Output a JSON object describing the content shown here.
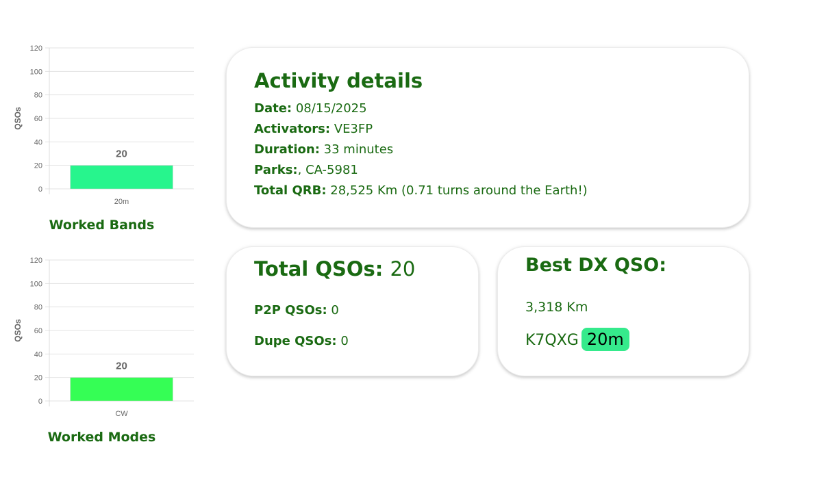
{
  "charts": [
    {
      "id": "bands",
      "caption": "Worked Bands",
      "ylabel": "QSOs",
      "bar_color": "#27f58d",
      "chart_data": {
        "type": "bar",
        "categories": [
          "20m"
        ],
        "values": [
          20
        ],
        "ylim": [
          0,
          120
        ],
        "yticks": [
          0,
          20,
          40,
          60,
          80,
          100,
          120
        ],
        "ylabel": "QSOs",
        "xlabel": "",
        "title": ""
      }
    },
    {
      "id": "modes",
      "caption": "Worked Modes",
      "ylabel": "QSOs",
      "bar_color": "#35fe55",
      "chart_data": {
        "type": "bar",
        "categories": [
          "CW"
        ],
        "values": [
          20
        ],
        "ylim": [
          0,
          120
        ],
        "yticks": [
          0,
          20,
          40,
          60,
          80,
          100,
          120
        ],
        "ylabel": "QSOs",
        "xlabel": "",
        "title": ""
      }
    }
  ],
  "activity": {
    "title": "Activity details",
    "date_label": "Date:",
    "date_value": "08/15/2025",
    "activators_label": "Activators:",
    "activators_value": "VE3FP",
    "duration_label": "Duration:",
    "duration_value": "33 minutes",
    "parks_label": "Parks:",
    "parks_value": ", CA-5981",
    "qrb_label": "Total QRB:",
    "qrb_value": "28,525 Km (0.71 turns around the Earth!)"
  },
  "totals": {
    "title_label": "Total QSOs:",
    "title_value": "20",
    "p2p_label": "P2P QSOs:",
    "p2p_value": "0",
    "dupe_label": "Dupe QSOs:",
    "dupe_value": "0"
  },
  "best_dx": {
    "title": "Best DX QSO:",
    "distance": "3,318 Km",
    "callsign": "K7QXG",
    "band": "20m"
  },
  "colors": {
    "accent_green": "#1a6a12",
    "badge": "#35ea8c"
  }
}
